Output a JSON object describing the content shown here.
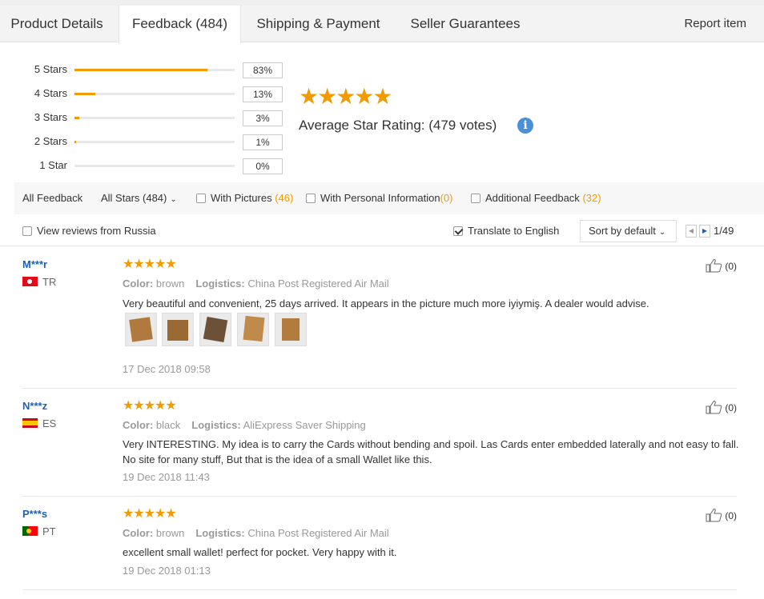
{
  "tabs": [
    {
      "label": "Product Details"
    },
    {
      "label": "Feedback (484)"
    },
    {
      "label": "Shipping & Payment"
    },
    {
      "label": "Seller Guarantees"
    }
  ],
  "report_item": "Report item",
  "distribution": [
    {
      "label": "5 Stars",
      "pct": "83%",
      "fraction": 0.83
    },
    {
      "label": "4 Stars",
      "pct": "13%",
      "fraction": 0.13
    },
    {
      "label": "3 Stars",
      "pct": "3%",
      "fraction": 0.03
    },
    {
      "label": "2 Stars",
      "pct": "1%",
      "fraction": 0.01
    },
    {
      "label": "1 Star",
      "pct": "0%",
      "fraction": 0.0
    }
  ],
  "average": {
    "stars": "★★★★★",
    "text": "Average Star Rating:  (479 votes)",
    "info_icon": "i",
    "star_color": "#f29b00"
  },
  "filters": {
    "all_feedback": "All Feedback",
    "all_stars": "All Stars (484)",
    "with_pictures": "With Pictures",
    "with_pictures_count": "(46)",
    "with_personal": "With Personal Information",
    "with_personal_count": "(0)",
    "additional": "Additional Feedback",
    "additional_count": "(32)"
  },
  "options": {
    "view_russia": "View reviews from Russia",
    "translate": "Translate to English",
    "translate_checked": true,
    "sort": "Sort by default",
    "page": "1/49"
  },
  "reviews": [
    {
      "user": "M***r",
      "country": "TR",
      "stars": "★★★★★",
      "color_label": "Color:",
      "color": "brown",
      "logistics_label": "Logistics:",
      "logistics": "China Post Registered Air Mail",
      "text": "Very beautiful and convenient, 25 days arrived. It appears in the picture much more iyiymiş. A dealer would advise.",
      "date": "17 Dec 2018 09:58",
      "helpful": "(0)"
    },
    {
      "user": "N***z",
      "country": "ES",
      "stars": "★★★★★",
      "color_label": "Color:",
      "color": "black",
      "logistics_label": "Logistics:",
      "logistics": "AliExpress Saver Shipping",
      "text": "Very INTERESTING. My idea is to carry the Cards without bending and spoil. Las Cards enter embedded laterally and not easy to fall. No site for many stuff, But that is the idea of a small Wallet like this.",
      "date": "19 Dec 2018 11:43",
      "helpful": "(0)"
    },
    {
      "user": "P***s",
      "country": "PT",
      "stars": "★★★★★",
      "color_label": "Color:",
      "color": "brown",
      "logistics_label": "Logistics:",
      "logistics": "China Post Registered Air Mail",
      "text": "excellent small wallet! perfect for pocket. Very happy with it.",
      "date": "19 Dec 2018 01:13",
      "helpful": "(0)"
    }
  ]
}
